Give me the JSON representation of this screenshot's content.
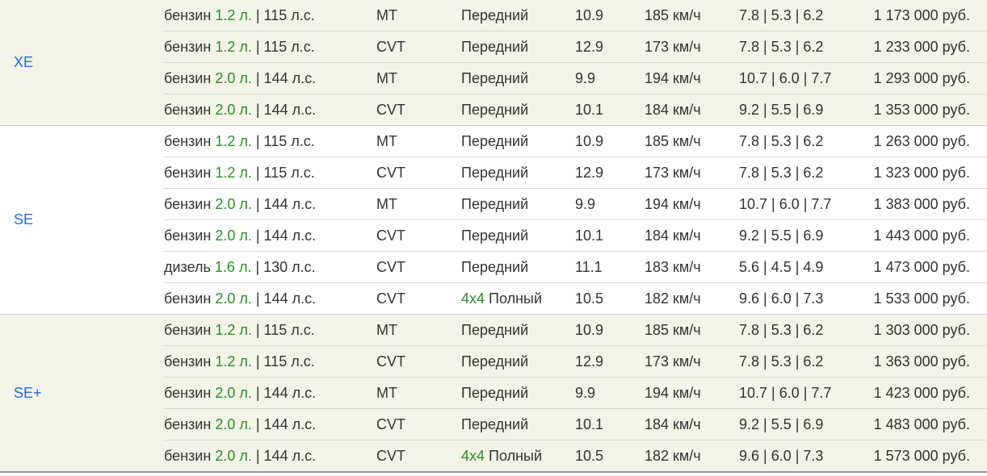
{
  "groups": [
    {
      "trim": "XE",
      "rows": [
        {
          "fuel": "бензин",
          "volume": "1.2 л.",
          "power": "| 115 л.с.",
          "transmission": "MT",
          "drive_badge": "",
          "drive": "Передний",
          "accel": "10.9",
          "speed": "185 км/ч",
          "consumption": "7.8 | 5.3 | 6.2",
          "price": "1 173 000 руб."
        },
        {
          "fuel": "бензин",
          "volume": "1.2 л.",
          "power": "| 115 л.с.",
          "transmission": "CVT",
          "drive_badge": "",
          "drive": "Передний",
          "accel": "12.9",
          "speed": "173 км/ч",
          "consumption": "7.8 | 5.3 | 6.2",
          "price": "1 233 000 руб."
        },
        {
          "fuel": "бензин",
          "volume": "2.0 л.",
          "power": "| 144 л.с.",
          "transmission": "MT",
          "drive_badge": "",
          "drive": "Передний",
          "accel": "9.9",
          "speed": "194 км/ч",
          "consumption": "10.7 | 6.0 | 7.7",
          "price": "1 293 000 руб."
        },
        {
          "fuel": "бензин",
          "volume": "2.0 л.",
          "power": "| 144 л.с.",
          "transmission": "CVT",
          "drive_badge": "",
          "drive": "Передний",
          "accel": "10.1",
          "speed": "184 км/ч",
          "consumption": "9.2 | 5.5 | 6.9",
          "price": "1 353 000 руб."
        }
      ]
    },
    {
      "trim": "SE",
      "rows": [
        {
          "fuel": "бензин",
          "volume": "1.2 л.",
          "power": "| 115 л.с.",
          "transmission": "MT",
          "drive_badge": "",
          "drive": "Передний",
          "accel": "10.9",
          "speed": "185 км/ч",
          "consumption": "7.8 | 5.3 | 6.2",
          "price": "1 263 000 руб."
        },
        {
          "fuel": "бензин",
          "volume": "1.2 л.",
          "power": "| 115 л.с.",
          "transmission": "CVT",
          "drive_badge": "",
          "drive": "Передний",
          "accel": "12.9",
          "speed": "173 км/ч",
          "consumption": "7.8 | 5.3 | 6.2",
          "price": "1 323 000 руб."
        },
        {
          "fuel": "бензин",
          "volume": "2.0 л.",
          "power": "| 144 л.с.",
          "transmission": "MT",
          "drive_badge": "",
          "drive": "Передний",
          "accel": "9.9",
          "speed": "194 км/ч",
          "consumption": "10.7 | 6.0 | 7.7",
          "price": "1 383 000 руб."
        },
        {
          "fuel": "бензин",
          "volume": "2.0 л.",
          "power": "| 144 л.с.",
          "transmission": "CVT",
          "drive_badge": "",
          "drive": "Передний",
          "accel": "10.1",
          "speed": "184 км/ч",
          "consumption": "9.2 | 5.5 | 6.9",
          "price": "1 443 000 руб."
        },
        {
          "fuel": "дизель",
          "volume": "1.6 л.",
          "power": "| 130 л.с.",
          "transmission": "CVT",
          "drive_badge": "",
          "drive": "Передний",
          "accel": "11.1",
          "speed": "183 км/ч",
          "consumption": "5.6 | 4.5 | 4.9",
          "price": "1 473 000 руб."
        },
        {
          "fuel": "бензин",
          "volume": "2.0 л.",
          "power": "| 144 л.с.",
          "transmission": "CVT",
          "drive_badge": "4x4",
          "drive": "Полный",
          "accel": "10.5",
          "speed": "182 км/ч",
          "consumption": "9.6 | 6.0 | 7.3",
          "price": "1 533 000 руб."
        }
      ]
    },
    {
      "trim": "SE+",
      "rows": [
        {
          "fuel": "бензин",
          "volume": "1.2 л.",
          "power": "| 115 л.с.",
          "transmission": "MT",
          "drive_badge": "",
          "drive": "Передний",
          "accel": "10.9",
          "speed": "185 км/ч",
          "consumption": "7.8 | 5.3 | 6.2",
          "price": "1 303 000 руб."
        },
        {
          "fuel": "бензин",
          "volume": "1.2 л.",
          "power": "| 115 л.с.",
          "transmission": "CVT",
          "drive_badge": "",
          "drive": "Передний",
          "accel": "12.9",
          "speed": "173 км/ч",
          "consumption": "7.8 | 5.3 | 6.2",
          "price": "1 363 000 руб."
        },
        {
          "fuel": "бензин",
          "volume": "2.0 л.",
          "power": "| 144 л.с.",
          "transmission": "MT",
          "drive_badge": "",
          "drive": "Передний",
          "accel": "9.9",
          "speed": "194 км/ч",
          "consumption": "10.7 | 6.0 | 7.7",
          "price": "1 423 000 руб."
        },
        {
          "fuel": "бензин",
          "volume": "2.0 л.",
          "power": "| 144 л.с.",
          "transmission": "CVT",
          "drive_badge": "",
          "drive": "Передний",
          "accel": "10.1",
          "speed": "184 км/ч",
          "consumption": "9.2 | 5.5 | 6.9",
          "price": "1 483 000 руб."
        },
        {
          "fuel": "бензин",
          "volume": "2.0 л.",
          "power": "| 144 л.с.",
          "transmission": "CVT",
          "drive_badge": "4x4",
          "drive": "Полный",
          "accel": "10.5",
          "speed": "182 км/ч",
          "consumption": "9.6 | 6.0 | 7.3",
          "price": "1 573 000 руб."
        }
      ]
    }
  ],
  "colors": {
    "trim_link": "#2a6bd8",
    "highlight": "#2e8b28",
    "text": "#333333",
    "shade": "#f3f3e7"
  }
}
